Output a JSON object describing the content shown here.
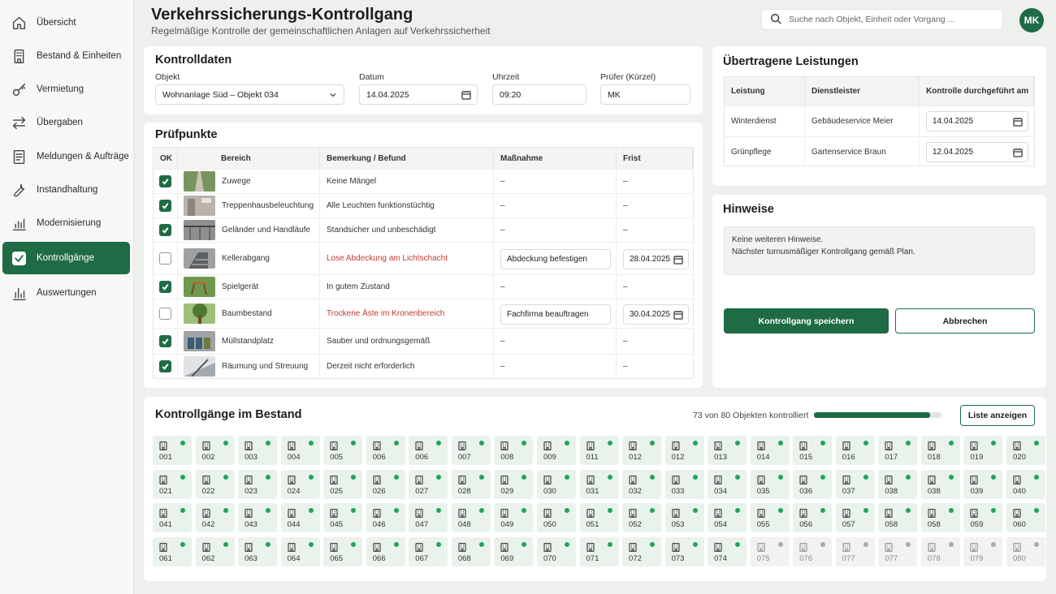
{
  "nav": [
    {
      "label": "Übersicht",
      "icon": "home-icon"
    },
    {
      "label": "Bestand & Einheiten",
      "icon": "building-icon"
    },
    {
      "label": "Vermietung",
      "icon": "key-icon"
    },
    {
      "label": "Übergaben",
      "icon": "swap-icon"
    },
    {
      "label": "Meldungen & Aufträge",
      "icon": "document-icon"
    },
    {
      "label": "Instandhaltung",
      "icon": "wrench-icon"
    },
    {
      "label": "Modernisierung",
      "icon": "bar-chart-icon"
    },
    {
      "label": "Kontrollgänge",
      "icon": "checkbox-icon",
      "active": true
    },
    {
      "label": "Auswertungen",
      "icon": "analytics-icon"
    }
  ],
  "header": {
    "title": "Verkehrssicherungs-Kontrollgang",
    "subtitle": "Regelmäßige Kontrolle der gemeinschaftlichen Anlagen auf Verkehrssicherheit",
    "search_placeholder": "Suche nach Objekt, Einheit oder Vorgang ...",
    "avatar": "MK"
  },
  "kontrolldaten": {
    "title": "Kontrolldaten",
    "objekt_label": "Objekt",
    "objekt_value": "Wohnanlage Süd – Objekt 034",
    "datum_label": "Datum",
    "datum_value": "14.04.2025",
    "uhrzeit_label": "Uhrzeit",
    "uhrzeit_value": "09:20",
    "pruefer_label": "Prüfer (Kürzel)",
    "pruefer_value": "MK"
  },
  "pruefpunkte": {
    "title": "Prüfpunkte",
    "headers": [
      "OK",
      "Bereich",
      "Bemerkung / Befund",
      "Maßnahme",
      "Frist"
    ],
    "rows": [
      {
        "ok": true,
        "bereich": "Zuwege",
        "befund": "Keine Mängel",
        "massnahme": "–",
        "frist": "–",
        "thumb": "path"
      },
      {
        "ok": true,
        "bereich": "Treppenhausbeleuchtung",
        "befund": "Alle Leuchten funktionstüchtig",
        "massnahme": "–",
        "frist": "–",
        "thumb": "stair"
      },
      {
        "ok": true,
        "bereich": "Geländer und Handläufe",
        "befund": "Standsicher und unbeschädigt",
        "massnahme": "–",
        "frist": "–",
        "thumb": "rail"
      },
      {
        "ok": false,
        "bereich": "Kellerabgang",
        "befund": "Lose Abdeckung am Lichtschacht",
        "massnahme": "Abdeckung befestigen",
        "frist": "28.04.2025",
        "thumb": "cellar"
      },
      {
        "ok": true,
        "bereich": "Spielgerät",
        "befund": "In gutem Zustand",
        "massnahme": "–",
        "frist": "–",
        "thumb": "play"
      },
      {
        "ok": false,
        "bereich": "Baumbestand",
        "befund": "Trockene Äste im Kronenbereich",
        "massnahme": "Fachfirma beauftragen",
        "frist": "30.04.2025",
        "thumb": "tree"
      },
      {
        "ok": true,
        "bereich": "Müllstandplatz",
        "befund": "Sauber und ordnungsgemäß",
        "massnahme": "–",
        "frist": "–",
        "thumb": "bins"
      },
      {
        "ok": true,
        "bereich": "Räumung und Streuung",
        "befund": "Derzeit nicht erforderlich",
        "massnahme": "–",
        "frist": "–",
        "thumb": "snow"
      }
    ]
  },
  "leistungen": {
    "title": "Übertragene Leistungen",
    "headers": [
      "Leistung",
      "Dienstleister",
      "Kontrolle durchgeführt am"
    ],
    "rows": [
      {
        "leistung": "Winterdienst",
        "dienstleister": "Gebäudeservice Meier",
        "datum": "14.04.2025"
      },
      {
        "leistung": "Grünpflege",
        "dienstleister": "Gartenservice Braun",
        "datum": "12.04.2025"
      }
    ]
  },
  "hinweise": {
    "title": "Hinweise",
    "line1": "Keine weiteren Hinweise.",
    "line2": "Nächster turnusmäßiger Kontrollgang gemäß Plan.",
    "save": "Kontrollgang speichern",
    "cancel": "Abbrechen"
  },
  "bestand": {
    "title": "Kontrollgänge im Bestand",
    "progress_text": "73 von 80 Objekten kontrolliert",
    "progress": 0.9125,
    "list_button": "Liste anzeigen",
    "tiles": [
      "001",
      "002",
      "003",
      "004",
      "005",
      "006",
      "006",
      "007",
      "008",
      "009",
      "011",
      "012",
      "012",
      "013",
      "014",
      "015",
      "016",
      "017",
      "018",
      "019",
      "020",
      "021",
      "022",
      "023",
      "024",
      "025",
      "026",
      "027",
      "028",
      "029",
      "030",
      "031",
      "032",
      "033",
      "034",
      "035",
      "036",
      "037",
      "038",
      "038",
      "039",
      "040",
      "041",
      "042",
      "043",
      "044",
      "045",
      "046",
      "047",
      "048",
      "049",
      "050",
      "051",
      "052",
      "053",
      "054",
      "055",
      "056",
      "057",
      "058",
      "058",
      "059",
      "060",
      "061",
      "062",
      "063",
      "064",
      "065",
      "066",
      "067",
      "068",
      "069",
      "070",
      "071",
      "072",
      "073",
      "074",
      "075",
      "076",
      "077",
      "077",
      "078",
      "079",
      "080"
    ],
    "pending_from": 77
  },
  "colors": {
    "accent": "#1e6b45",
    "done": "#22a35a",
    "issue": "#c43a2e"
  }
}
